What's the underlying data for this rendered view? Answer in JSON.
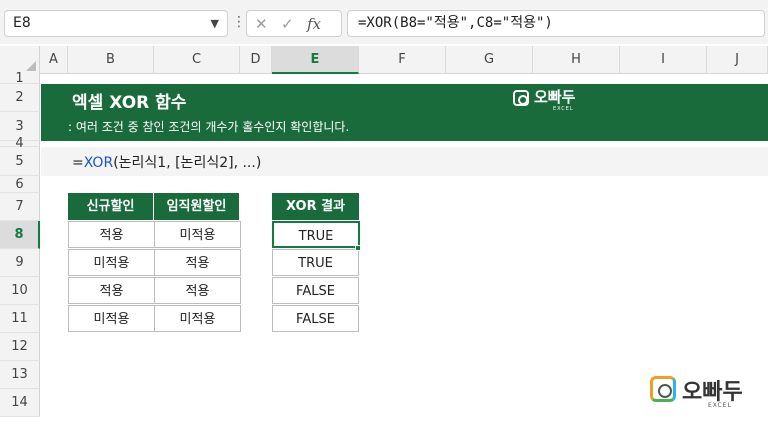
{
  "formula_bar": {
    "name_box": "E8",
    "cancel_symbol": "✕",
    "enter_symbol": "✓",
    "fx_symbol": "fx",
    "formula": "=XOR(B8=\"적용\",C8=\"적용\")"
  },
  "columns": [
    "A",
    "B",
    "C",
    "D",
    "E",
    "F",
    "G",
    "H",
    "I",
    "J"
  ],
  "selected_column": "E",
  "rows": [
    "1",
    "2",
    "3",
    "4",
    "5",
    "6",
    "7",
    "8",
    "9",
    "10",
    "11",
    "12",
    "13",
    "14"
  ],
  "selected_row": "8",
  "banner": {
    "title": "엑셀 XOR 함수",
    "subtitle": ": 여러 조건 중 참인 조건의 개수가 홀수인지 확인합니다.",
    "brand_name": "오빠두",
    "brand_sub": "EXCEL",
    "color": "#1a6b3b"
  },
  "syntax": {
    "prefix": "=",
    "function_name": "XOR",
    "args": "(논리식1, [논리식2], ...)"
  },
  "input_table": {
    "headers": [
      "신규할인",
      "임직원할인"
    ],
    "rows": [
      [
        "적용",
        "미적용"
      ],
      [
        "미적용",
        "적용"
      ],
      [
        "적용",
        "적용"
      ],
      [
        "미적용",
        "미적용"
      ]
    ]
  },
  "result_table": {
    "header": "XOR 결과",
    "values": [
      "TRUE",
      "TRUE",
      "FALSE",
      "FALSE"
    ]
  },
  "footer_logo": {
    "name": "오빠두",
    "sub": "EXCEL"
  }
}
